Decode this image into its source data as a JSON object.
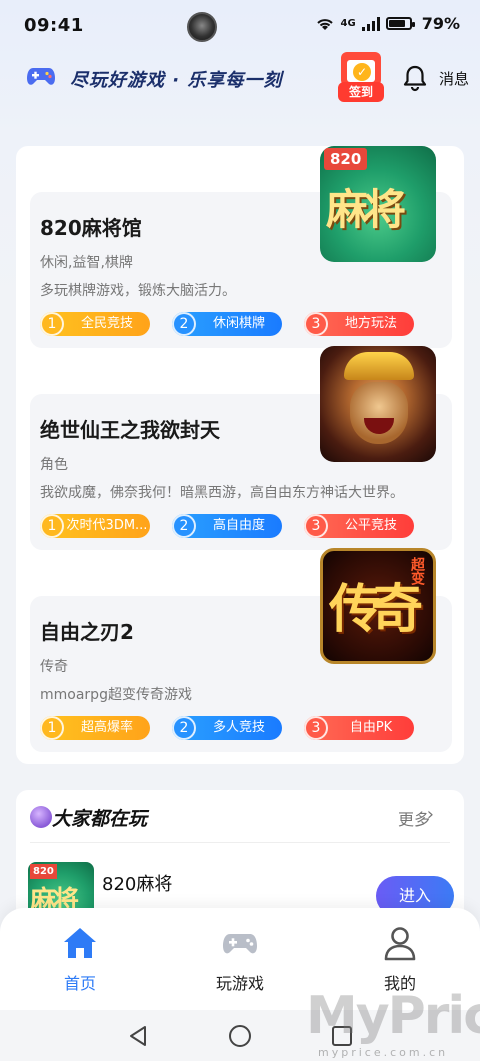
{
  "status_bar": {
    "time": "09:41",
    "network": "4G",
    "battery_percent": "79%"
  },
  "header": {
    "slogan": "尽玩好游戏 · 乐享每一刻",
    "checkin_label": "签到",
    "message_label": "消息"
  },
  "games": [
    {
      "title": "820麻将馆",
      "genre": "休闲,益智,棋牌",
      "description": "多玩棋牌游戏，锻炼大脑活力。",
      "icon": {
        "badge": "820",
        "glyphs": "麻将"
      },
      "tags": [
        {
          "num": "1",
          "label": "全民竞技"
        },
        {
          "num": "2",
          "label": "休闲棋牌"
        },
        {
          "num": "3",
          "label": "地方玩法"
        }
      ]
    },
    {
      "title": "绝世仙王之我欲封天",
      "genre": "角色",
      "description": "我欲成魔，佛奈我何！暗黑西游，高自由东方神话大世界。",
      "icon": {
        "name": "monkey-king-icon"
      },
      "tags": [
        {
          "num": "1",
          "label": "次时代3DM..."
        },
        {
          "num": "2",
          "label": "高自由度"
        },
        {
          "num": "3",
          "label": "公平竞技"
        }
      ]
    },
    {
      "title": "自由之刃2",
      "genre": "传奇",
      "description": "mmoarpg超变传奇游戏",
      "icon": {
        "glyphs": "传奇",
        "small": "超变"
      },
      "tags": [
        {
          "num": "1",
          "label": "超高爆率"
        },
        {
          "num": "2",
          "label": "多人竞技"
        },
        {
          "num": "3",
          "label": "自由PK"
        }
      ]
    }
  ],
  "popular": {
    "title": "大家都在玩",
    "more_label": "更多",
    "items": [
      {
        "name": "820麻将",
        "badge": "820",
        "glyphs": "麻将",
        "button": "进入"
      }
    ]
  },
  "bottom_nav": {
    "items": [
      {
        "label": "首页",
        "active": true
      },
      {
        "label": "玩游戏",
        "active": false
      },
      {
        "label": "我的",
        "active": false
      }
    ]
  },
  "watermark": {
    "text": "MyPrice",
    "sub": "myprice.com.cn"
  },
  "colors": {
    "accent": "#2e7bf6",
    "tag_yellow": "#ffb81e",
    "tag_blue": "#2792ff",
    "tag_red": "#ff5a48"
  }
}
